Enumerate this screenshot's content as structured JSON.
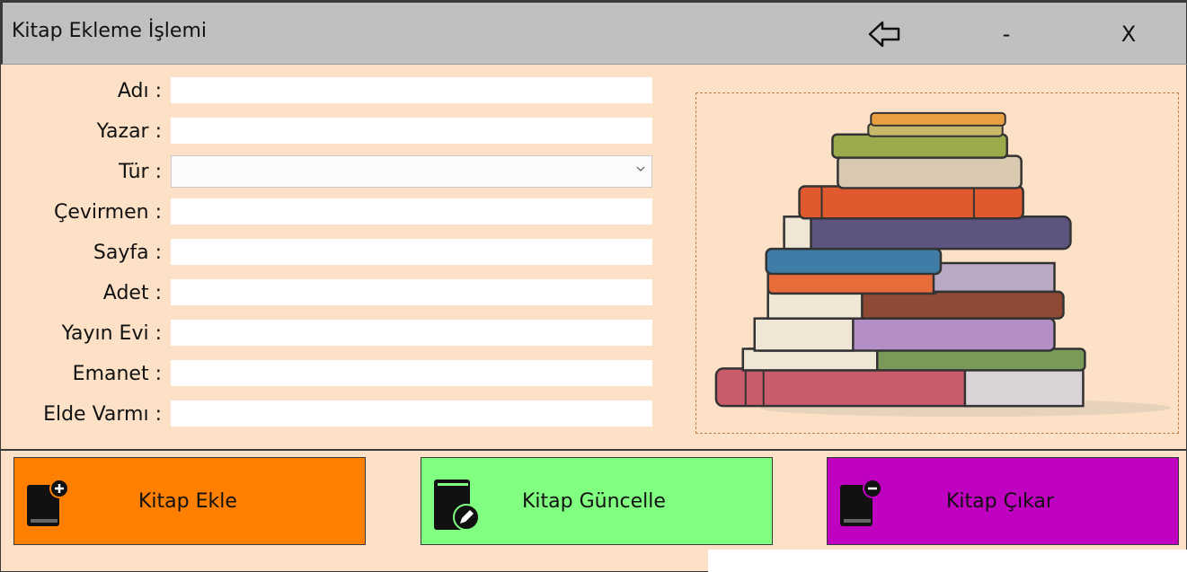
{
  "window": {
    "title": "Kitap Ekleme İşlemi",
    "minimize_label": "-",
    "close_label": "X"
  },
  "form": {
    "fields": [
      {
        "label": "Adı :",
        "value": ""
      },
      {
        "label": "Yazar :",
        "value": ""
      },
      {
        "label": "Tür :",
        "value": ""
      },
      {
        "label": "Çevirmen :",
        "value": ""
      },
      {
        "label": "Sayfa :",
        "value": ""
      },
      {
        "label": "Adet :",
        "value": ""
      },
      {
        "label": "Yayın Evi :",
        "value": ""
      },
      {
        "label": "Emanet :",
        "value": ""
      },
      {
        "label": "Elde Varmı :",
        "value": ""
      }
    ]
  },
  "actions": {
    "add": {
      "label": "Kitap Ekle",
      "color": "#ff8000",
      "icon": "book-add-icon"
    },
    "update": {
      "label": "Kitap Güncelle",
      "color": "#80ff80",
      "icon": "book-edit-icon"
    },
    "remove": {
      "label": "Kitap Çıkar",
      "color": "#c000c0",
      "icon": "book-remove-icon"
    }
  },
  "colors": {
    "background": "#fde1c6",
    "titlebar": "#c0c0c0"
  },
  "icons": {
    "back": "back-arrow-icon",
    "picture": "book-stack-image"
  }
}
